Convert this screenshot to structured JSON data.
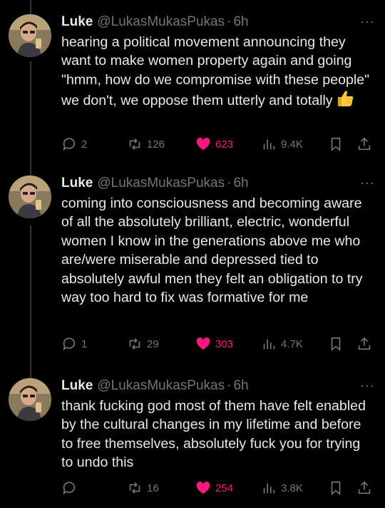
{
  "tweets": [
    {
      "name": "Luke",
      "handle": "@LukasMukasPukas",
      "separator": "·",
      "time": "6h",
      "more": "···",
      "text": "hearing a political movement announcing they want to make women property again and going \"hmm, how do we compromise with these people\" we don't, we oppose them utterly and totally",
      "emoji": "thumbs-up",
      "replies": "2",
      "retweets": "126",
      "likes": "623",
      "views": "9.4K"
    },
    {
      "name": "Luke",
      "handle": "@LukasMukasPukas",
      "separator": "·",
      "time": "6h",
      "more": "···",
      "text": "coming into consciousness and becoming aware of all the absolutely brilliant, electric, wonderful women I know in the generations above me who are/were miserable and depressed tied to absolutely awful men they felt an obligation to try way too hard to fix was formative for me",
      "replies": "1",
      "retweets": "29",
      "likes": "303",
      "views": "4.7K"
    },
    {
      "name": "Luke",
      "handle": "@LukasMukasPukas",
      "separator": "·",
      "time": "6h",
      "more": "···",
      "text": "thank fucking god most of them have felt enabled by the cultural changes in my lifetime and before to free themselves, absolutely fuck you for trying to undo this",
      "replies": "",
      "retweets": "16",
      "likes": "254",
      "views": "3.8K"
    }
  ],
  "colors": {
    "background": "#000000",
    "text": "#e7e9ea",
    "muted": "#71767b",
    "like": "#f91880",
    "thread_line": "#333639"
  },
  "icons": [
    "reply-icon",
    "retweet-icon",
    "heart-icon",
    "views-icon",
    "bookmark-icon",
    "share-icon",
    "thumbs-up-emoji"
  ]
}
